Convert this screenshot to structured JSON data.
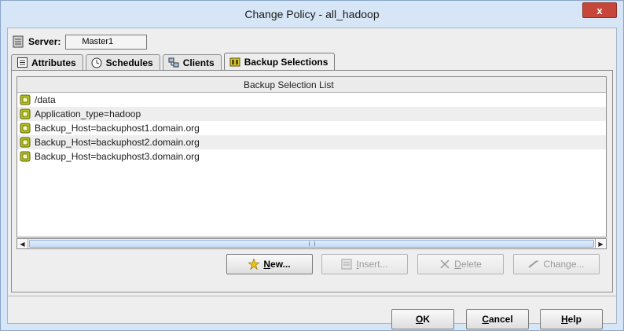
{
  "window": {
    "title": "Change Policy - all_hadoop",
    "close_glyph": "x"
  },
  "server": {
    "label": "Server:",
    "value": "Master1",
    "icon": "server-icon"
  },
  "tabs": [
    {
      "label": "Attributes",
      "icon": "attributes-icon",
      "active": false
    },
    {
      "label": "Schedules",
      "icon": "schedules-icon",
      "active": false
    },
    {
      "label": "Clients",
      "icon": "clients-icon",
      "active": false
    },
    {
      "label": "Backup Selections",
      "icon": "backup-selections-icon",
      "active": true
    }
  ],
  "list": {
    "header": "Backup Selection List",
    "items": [
      "/data",
      "Application_type=hadoop",
      "Backup_Host=backuphost1.domain.org",
      "Backup_Host=backuphost2.domain.org",
      "Backup_Host=backuphost3.domain.org"
    ]
  },
  "actions": {
    "new": {
      "first": "N",
      "rest": "ew...",
      "enabled": true
    },
    "insert": {
      "first": "I",
      "rest": "nsert...",
      "enabled": false
    },
    "delete": {
      "first": "D",
      "rest": "elete",
      "enabled": false
    },
    "change": {
      "pre": "Chan",
      "mid": "g",
      "post": "e...",
      "enabled": false
    }
  },
  "dialog": {
    "ok": {
      "first": "O",
      "rest": "K"
    },
    "cancel": {
      "first": "C",
      "rest": "ancel"
    },
    "help": {
      "first": "H",
      "rest": "elp"
    }
  },
  "colors": {
    "titlebar": "#d6e6f7",
    "close": "#c7463a",
    "list_icon": "#b7c21e"
  }
}
